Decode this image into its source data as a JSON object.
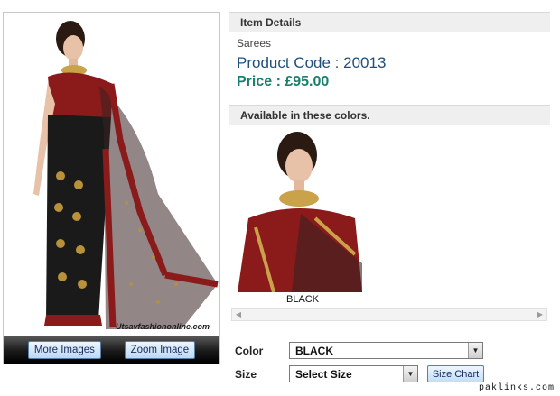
{
  "main_image": {
    "watermark": "Utsavfashiononline.com",
    "buttons": {
      "more_images": "More Images",
      "zoom_image": "Zoom Image"
    }
  },
  "details": {
    "header": "Item Details",
    "category": "Sarees",
    "product_code": "Product Code : 20013",
    "price": "Price : £95.00"
  },
  "colors": {
    "header": "Available in these colors.",
    "swatches": [
      {
        "label": "BLACK"
      }
    ]
  },
  "options": {
    "color_label": "Color",
    "color_value": "BLACK",
    "size_label": "Size",
    "size_value": "Select Size",
    "size_chart": "Size Chart"
  },
  "footer": {
    "site": "paklinks.com"
  },
  "palette": {
    "header_bg": "#efefef",
    "code_color": "#1f4f7a",
    "price_color": "#1b7f6e",
    "saree_red": "#8b1a1a",
    "saree_black": "#1a1a1a"
  },
  "icons": [
    "dropdown-arrow-icon",
    "scroll-left-icon",
    "scroll-right-icon"
  ]
}
